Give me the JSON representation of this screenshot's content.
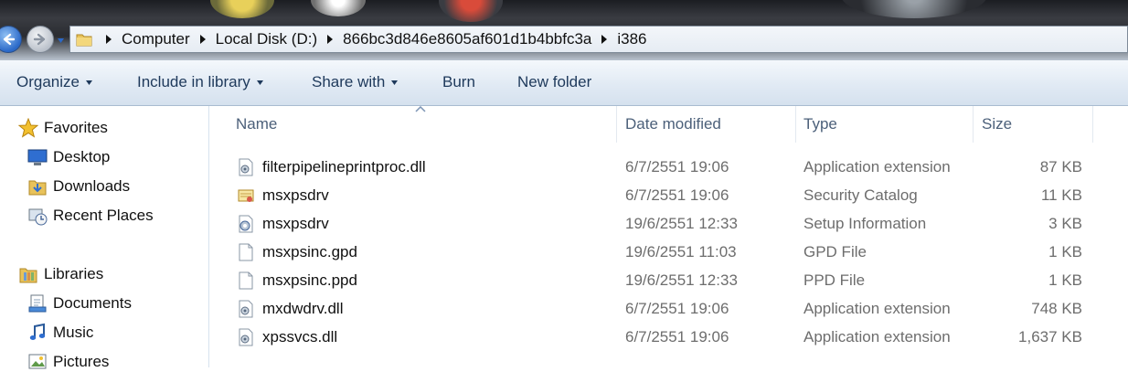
{
  "address_bar": {
    "crumbs": [
      "Computer",
      "Local Disk (D:)",
      "866bc3d846e8605af601d1b4bbfc3a",
      "i386"
    ]
  },
  "command_bar": {
    "organize": "Organize",
    "include_in_library": "Include in library",
    "share_with": "Share with",
    "burn": "Burn",
    "new_folder": "New folder"
  },
  "nav_pane": {
    "favorites": {
      "label": "Favorites",
      "items": [
        {
          "label": "Desktop",
          "icon": "desktop-icon"
        },
        {
          "label": "Downloads",
          "icon": "downloads-icon"
        },
        {
          "label": "Recent Places",
          "icon": "recent-places-icon"
        }
      ]
    },
    "libraries": {
      "label": "Libraries",
      "items": [
        {
          "label": "Documents",
          "icon": "documents-icon"
        },
        {
          "label": "Music",
          "icon": "music-icon"
        },
        {
          "label": "Pictures",
          "icon": "pictures-icon"
        }
      ]
    }
  },
  "columns": {
    "name": "Name",
    "date_modified": "Date modified",
    "type": "Type",
    "size": "Size"
  },
  "files": [
    {
      "name": "filterpipelineprintproc.dll",
      "date": "6/7/2551 19:06",
      "type": "Application extension",
      "size": "87 KB",
      "icon": "dll-icon"
    },
    {
      "name": "msxpsdrv",
      "date": "6/7/2551 19:06",
      "type": "Security Catalog",
      "size": "11 KB",
      "icon": "security-catalog-icon"
    },
    {
      "name": "msxpsdrv",
      "date": "19/6/2551 12:33",
      "type": "Setup Information",
      "size": "3 KB",
      "icon": "setup-information-icon"
    },
    {
      "name": "msxpsinc.gpd",
      "date": "19/6/2551 11:03",
      "type": "GPD File",
      "size": "1 KB",
      "icon": "blank-file-icon"
    },
    {
      "name": "msxpsinc.ppd",
      "date": "19/6/2551 12:33",
      "type": "PPD File",
      "size": "1 KB",
      "icon": "blank-file-icon"
    },
    {
      "name": "mxdwdrv.dll",
      "date": "6/7/2551 19:06",
      "type": "Application extension",
      "size": "748 KB",
      "icon": "dll-icon"
    },
    {
      "name": "xpssvcs.dll",
      "date": "6/7/2551 19:06",
      "type": "Application extension",
      "size": "1,637 KB",
      "icon": "dll-icon"
    }
  ]
}
